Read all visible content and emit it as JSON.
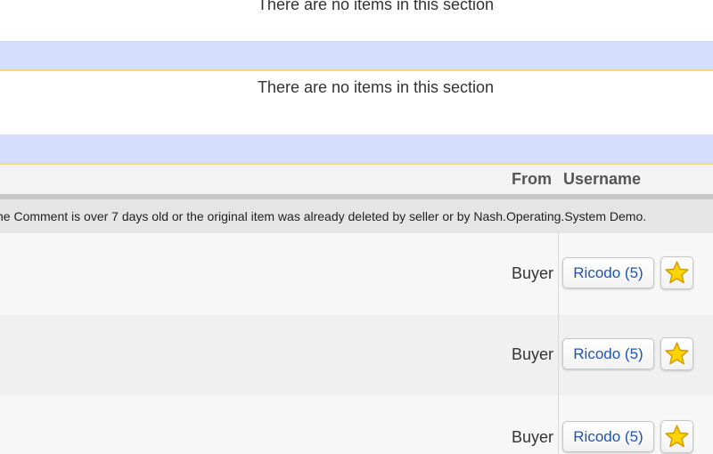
{
  "sections": {
    "empty_message_1": "There are no items in this section",
    "empty_message_2": "There are no items in this section"
  },
  "table": {
    "headers": {
      "from": "From",
      "username": "Username"
    },
    "notice": "he Comment is over 7 days old or the original item was already deleted by seller or by Nash.Operating.System Demo.",
    "rows": [
      {
        "from": "Buyer",
        "username": "Ricodo (5)",
        "icon": "star-icon"
      },
      {
        "from": "Buyer",
        "username": "Ricodo (5)",
        "icon": "star-icon"
      },
      {
        "from": "Buyer",
        "username": "Ricodo (5)",
        "icon": "star-icon"
      }
    ]
  },
  "colors": {
    "section_header_bg": "#d6defe",
    "section_header_border": "#f2dc7a",
    "link_blue": "#2255aa",
    "star_fill": "#ffd400",
    "star_stroke": "#d49a00"
  }
}
